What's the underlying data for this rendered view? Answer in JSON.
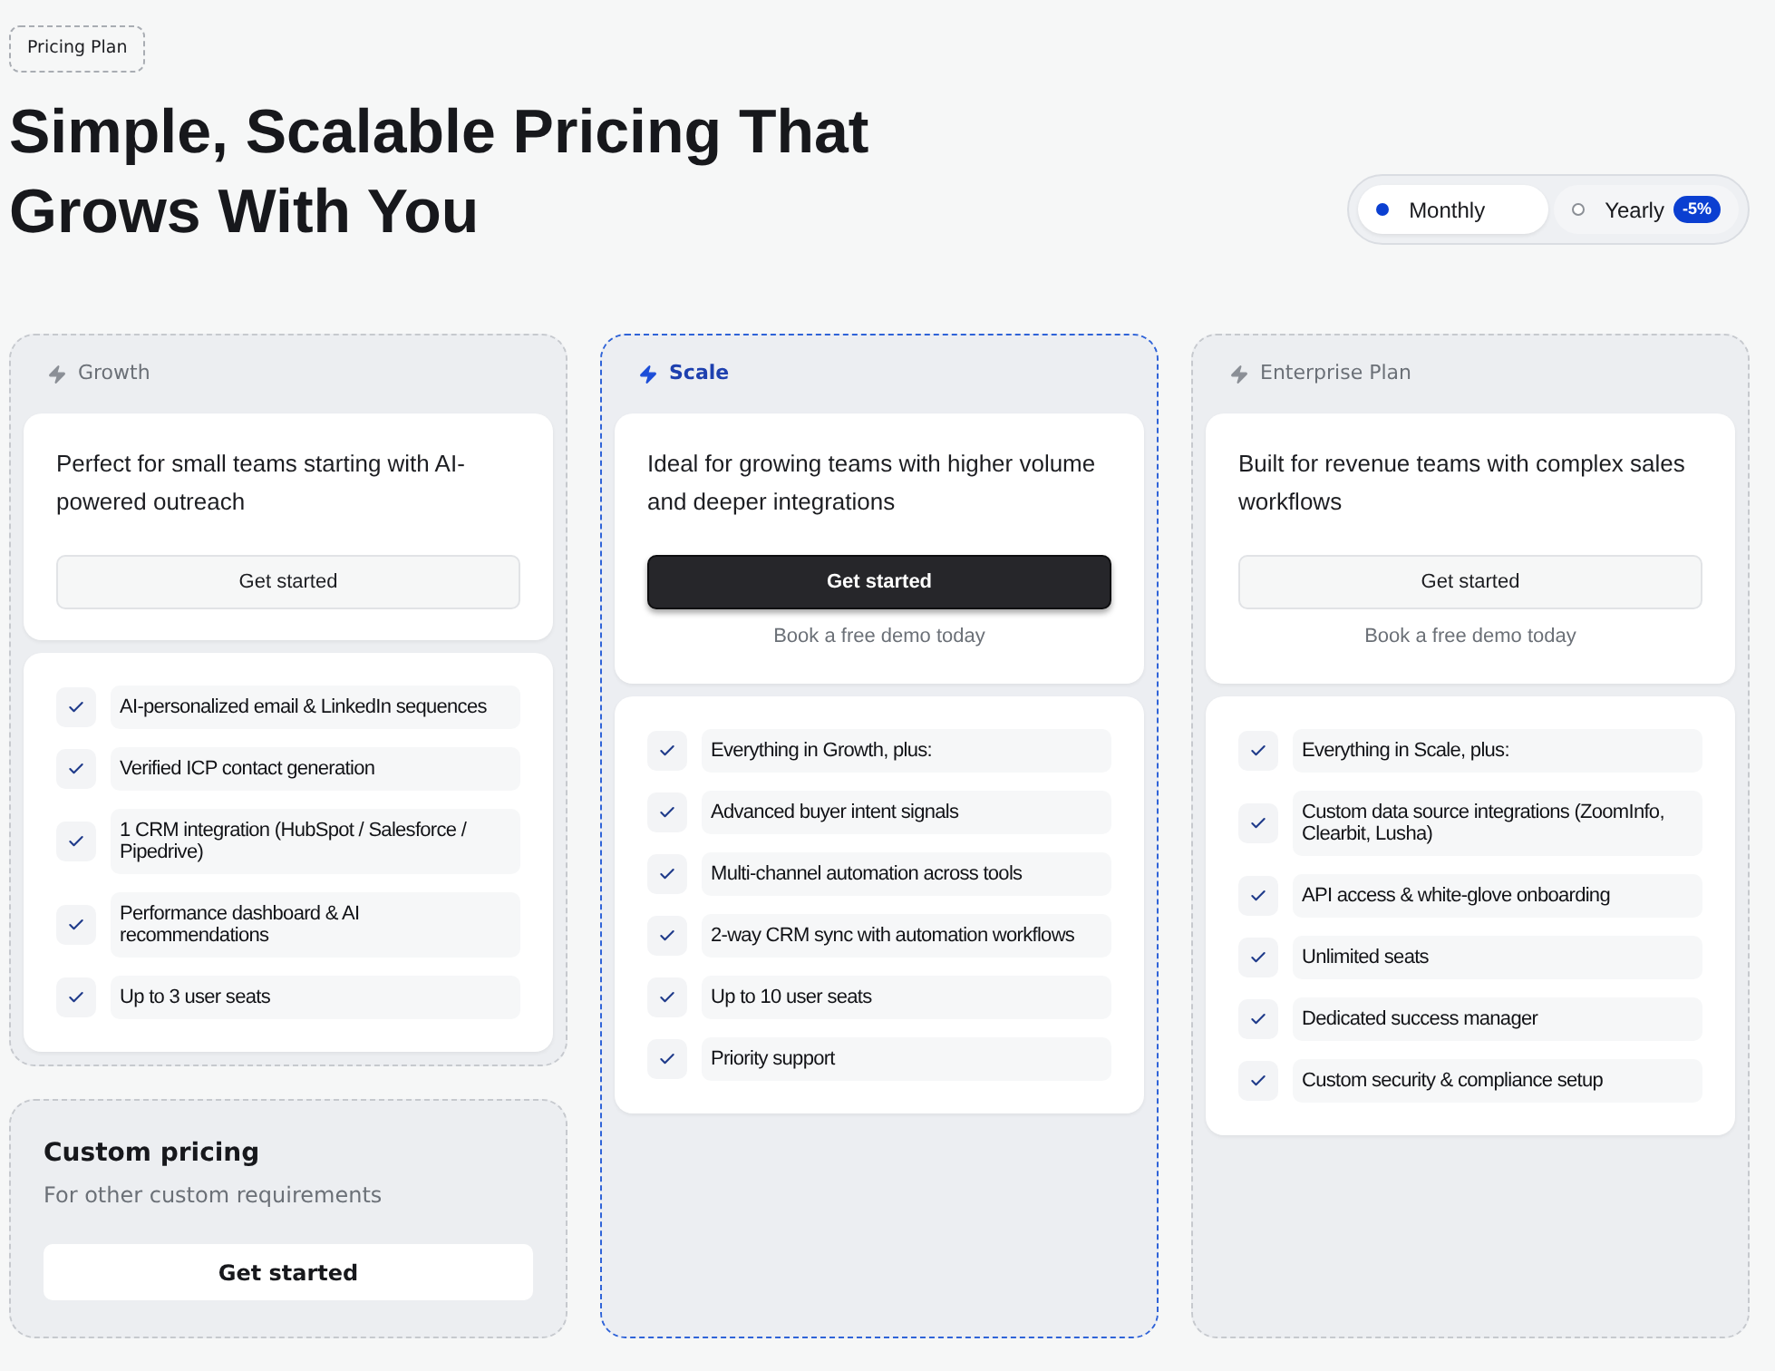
{
  "badge": "Pricing Plan",
  "title": "Simple, Scalable Pricing That Grows With You",
  "billing_toggle": [
    {
      "label": "Monthly",
      "selected": true
    },
    {
      "label": "Yearly",
      "selected": false,
      "badge": "-5%"
    }
  ],
  "plans": [
    {
      "name": "Growth",
      "featured": false,
      "description": "Perfect for small teams starting with AI-powered outreach",
      "button": "Get started",
      "features": [
        "AI-personalized email & LinkedIn sequences",
        "Verified ICP contact generation",
        "1 CRM integration (HubSpot / Salesforce / Pipedrive)",
        "Performance dashboard & AI recommendations",
        "Up to 3 user seats"
      ]
    },
    {
      "name": "Scale",
      "featured": true,
      "description": "Ideal for growing teams with higher volume and deeper integrations",
      "button": "Get started",
      "demo_link": "Book a free demo today",
      "features": [
        "Everything in Growth, plus:",
        "Advanced buyer intent signals",
        "Multi-channel automation across tools",
        "2-way CRM sync with automation workflows",
        "Up to 10 user seats",
        "Priority support"
      ]
    },
    {
      "name": "Enterprise Plan",
      "featured": false,
      "description": "Built for revenue teams with complex sales workflows",
      "button": "Get started",
      "demo_link": "Book a free demo today",
      "features": [
        "Everything in Scale, plus:",
        "Custom data source integrations (ZoomInfo, Clearbit, Lusha)",
        "API access & white-glove onboarding",
        "Unlimited seats",
        "Dedicated success manager",
        "Custom security & compliance setup"
      ]
    }
  ],
  "custom_pricing": {
    "title": "Custom pricing",
    "subtitle": "For other custom requirements",
    "button": "Get started"
  }
}
